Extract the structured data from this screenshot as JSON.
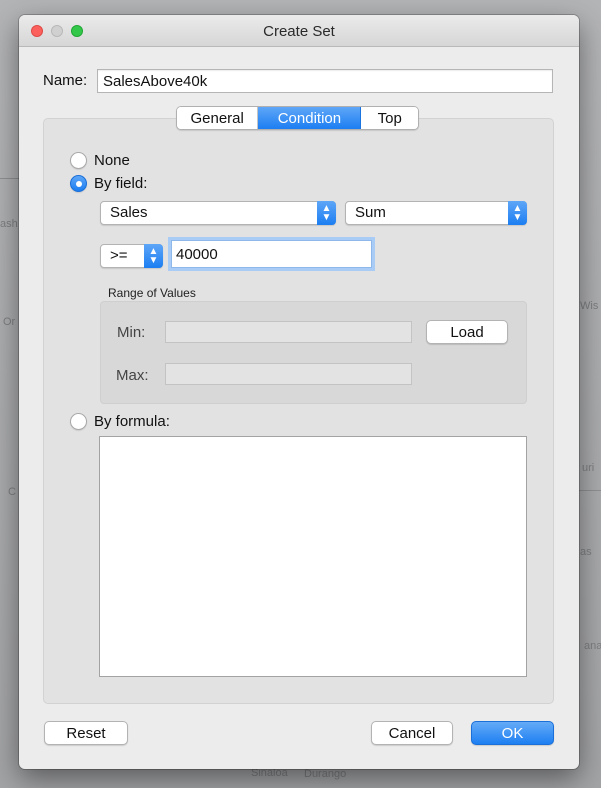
{
  "background": {
    "labels": [
      "ash",
      "Or",
      "Wis",
      "uri",
      "C",
      "as",
      "ana",
      "Sinaloa",
      "Durango"
    ]
  },
  "window": {
    "title": "Create Set"
  },
  "name": {
    "label": "Name:",
    "value": "SalesAbove40k"
  },
  "tabs": [
    {
      "label": "General",
      "active": false
    },
    {
      "label": "Condition",
      "active": true
    },
    {
      "label": "Top",
      "active": false
    }
  ],
  "condition": {
    "none_label": "None",
    "by_field_label": "By field:",
    "selected": "By field",
    "field": "Sales",
    "aggregation": "Sum",
    "operator": ">=",
    "value": "40000",
    "range": {
      "title": "Range of Values",
      "min_label": "Min:",
      "max_label": "Max:",
      "min_value": "",
      "max_value": "",
      "load_label": "Load"
    },
    "by_formula_label": "By formula:",
    "formula": ""
  },
  "buttons": {
    "reset": "Reset",
    "cancel": "Cancel",
    "ok": "OK"
  },
  "colors": {
    "accent": "#1c7ef2",
    "close": "#fc605c",
    "maximize": "#34c84a"
  },
  "icons": {
    "popup_arrows": "up-down-chevron-icon"
  }
}
